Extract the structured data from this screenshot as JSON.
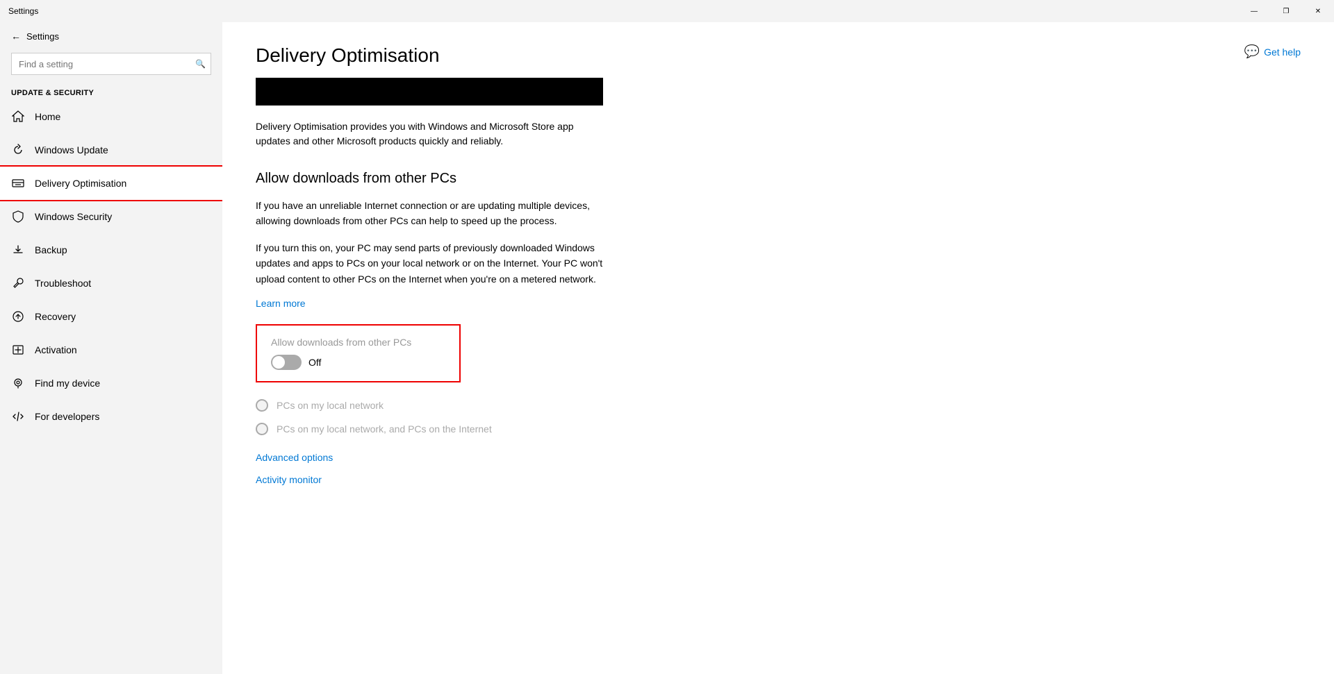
{
  "titlebar": {
    "title": "Settings",
    "minimize": "—",
    "maximize": "❐",
    "close": "✕"
  },
  "sidebar": {
    "back_label": "Settings",
    "search_placeholder": "Find a setting",
    "section_label": "Update & Security",
    "items": [
      {
        "id": "home",
        "icon": "home",
        "label": "Home"
      },
      {
        "id": "windows-update",
        "icon": "update",
        "label": "Windows Update"
      },
      {
        "id": "delivery-optimisation",
        "icon": "delivery",
        "label": "Delivery Optimisation",
        "active": true
      },
      {
        "id": "windows-security",
        "icon": "shield",
        "label": "Windows Security"
      },
      {
        "id": "backup",
        "icon": "backup",
        "label": "Backup"
      },
      {
        "id": "troubleshoot",
        "icon": "wrench",
        "label": "Troubleshoot"
      },
      {
        "id": "recovery",
        "icon": "recovery",
        "label": "Recovery"
      },
      {
        "id": "activation",
        "icon": "activation",
        "label": "Activation"
      },
      {
        "id": "find-my-device",
        "icon": "find",
        "label": "Find my device"
      },
      {
        "id": "for-developers",
        "icon": "dev",
        "label": "For developers"
      }
    ]
  },
  "content": {
    "page_title": "Delivery Optimisation",
    "description": "Delivery Optimisation provides you with Windows and Microsoft Store app updates and other Microsoft products quickly and reliably.",
    "section_title": "Allow downloads from other PCs",
    "body_text_1": "If you have an unreliable Internet connection or are updating multiple devices, allowing downloads from other PCs can help to speed up the process.",
    "body_text_2": "If you turn this on, your PC may send parts of previously downloaded Windows updates and apps to PCs on your local network or on the Internet. Your PC won't upload content to other PCs on the Internet when you're on a metered network.",
    "learn_more": "Learn more",
    "toggle_label": "Allow downloads from other PCs",
    "toggle_state": "Off",
    "radio_option_1": "PCs on my local network",
    "radio_option_2": "PCs on my local network, and PCs on the Internet",
    "advanced_options": "Advanced options",
    "activity_monitor": "Activity monitor",
    "get_help": "Get help"
  }
}
